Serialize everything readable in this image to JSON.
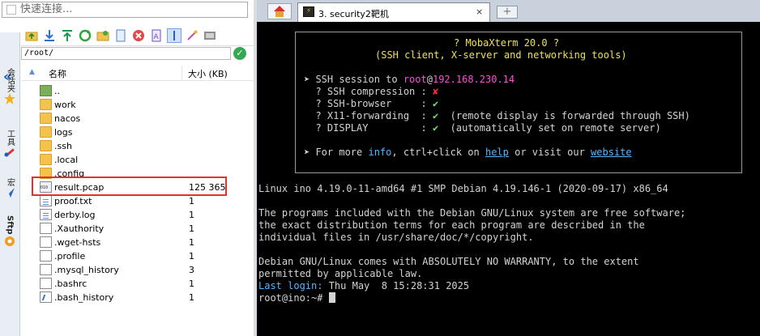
{
  "left_panel": {
    "quick_connect_placeholder": "快速连接...",
    "path_value": "/root/",
    "columns": {
      "name": "名称",
      "size": "大小 (KB)"
    },
    "files": [
      {
        "name": "..",
        "size": "",
        "kind": "folder-up"
      },
      {
        "name": "work",
        "size": "",
        "kind": "folder"
      },
      {
        "name": "nacos",
        "size": "",
        "kind": "folder"
      },
      {
        "name": "logs",
        "size": "",
        "kind": "folder"
      },
      {
        "name": ".ssh",
        "size": "",
        "kind": "folder"
      },
      {
        "name": ".local",
        "size": "",
        "kind": "folder"
      },
      {
        "name": ".config",
        "size": "",
        "kind": "folder"
      },
      {
        "name": "result.pcap",
        "size": "125 365",
        "kind": "pcap"
      },
      {
        "name": "proof.txt",
        "size": "1",
        "kind": "txt"
      },
      {
        "name": "derby.log",
        "size": "1",
        "kind": "txt"
      },
      {
        "name": ".Xauthority",
        "size": "1",
        "kind": "file"
      },
      {
        "name": ".wget-hsts",
        "size": "1",
        "kind": "file"
      },
      {
        "name": ".profile",
        "size": "1",
        "kind": "file"
      },
      {
        "name": ".mysql_history",
        "size": "3",
        "kind": "file"
      },
      {
        "name": ".bashrc",
        "size": "1",
        "kind": "file"
      },
      {
        "name": ".bash_history",
        "size": "1",
        "kind": "sh"
      }
    ],
    "vertical_tabs": [
      {
        "label": "会话夹",
        "icon": "star-icon"
      },
      {
        "label": "工具",
        "icon": "tools-icon"
      },
      {
        "label": "宏",
        "icon": "macro-icon"
      },
      {
        "label": "Sftp",
        "icon": "sftp-icon"
      }
    ]
  },
  "session_tab": {
    "title": "3. security2靶机",
    "close": "×"
  },
  "terminal": {
    "banner_title": "? MobaXterm 20.0 ?",
    "banner_subtitle": "(SSH client, X-server and networking tools)",
    "ssh_prefix": "➤ SSH session to ",
    "ssh_user": "root",
    "ssh_at": "@",
    "ssh_host": "192.168.230.14",
    "features": [
      {
        "label": "  ? SSH compression : ",
        "mark": "✘",
        "mark_color": "red",
        "note": ""
      },
      {
        "label": "  ? SSH-browser     : ",
        "mark": "✔",
        "mark_color": "green",
        "note": ""
      },
      {
        "label": "  ? X11-forwarding  : ",
        "mark": "✔",
        "mark_color": "green",
        "note": "  (remote display is forwarded through SSH)"
      },
      {
        "label": "  ? DISPLAY         : ",
        "mark": "✔",
        "mark_color": "green",
        "note": "  (automatically set on remote server)"
      }
    ],
    "more_prefix": "➤ For more ",
    "more_info": "info",
    "more_mid": ", ctrl+click on ",
    "more_help": "help",
    "more_mid2": " or visit our ",
    "more_website": "website",
    "uname": "Linux ino 4.19.0-11-amd64 #1 SMP Debian 4.19.146-1 (2020-09-17) x86_64",
    "motd": [
      "The programs included with the Debian GNU/Linux system are free software;",
      "the exact distribution terms for each program are described in the",
      "individual files in /usr/share/doc/*/copyright.",
      "",
      "Debian GNU/Linux comes with ABSOLUTELY NO WARRANTY, to the extent",
      "permitted by applicable law."
    ],
    "last_login_label": "Last login:",
    "last_login_value": " Thu May  8 15:28:31 2025",
    "prompt": "root@ino:~# "
  },
  "colors": {
    "red": "#ff3030",
    "green": "#7be37b",
    "highlight_border": "#e53030"
  }
}
